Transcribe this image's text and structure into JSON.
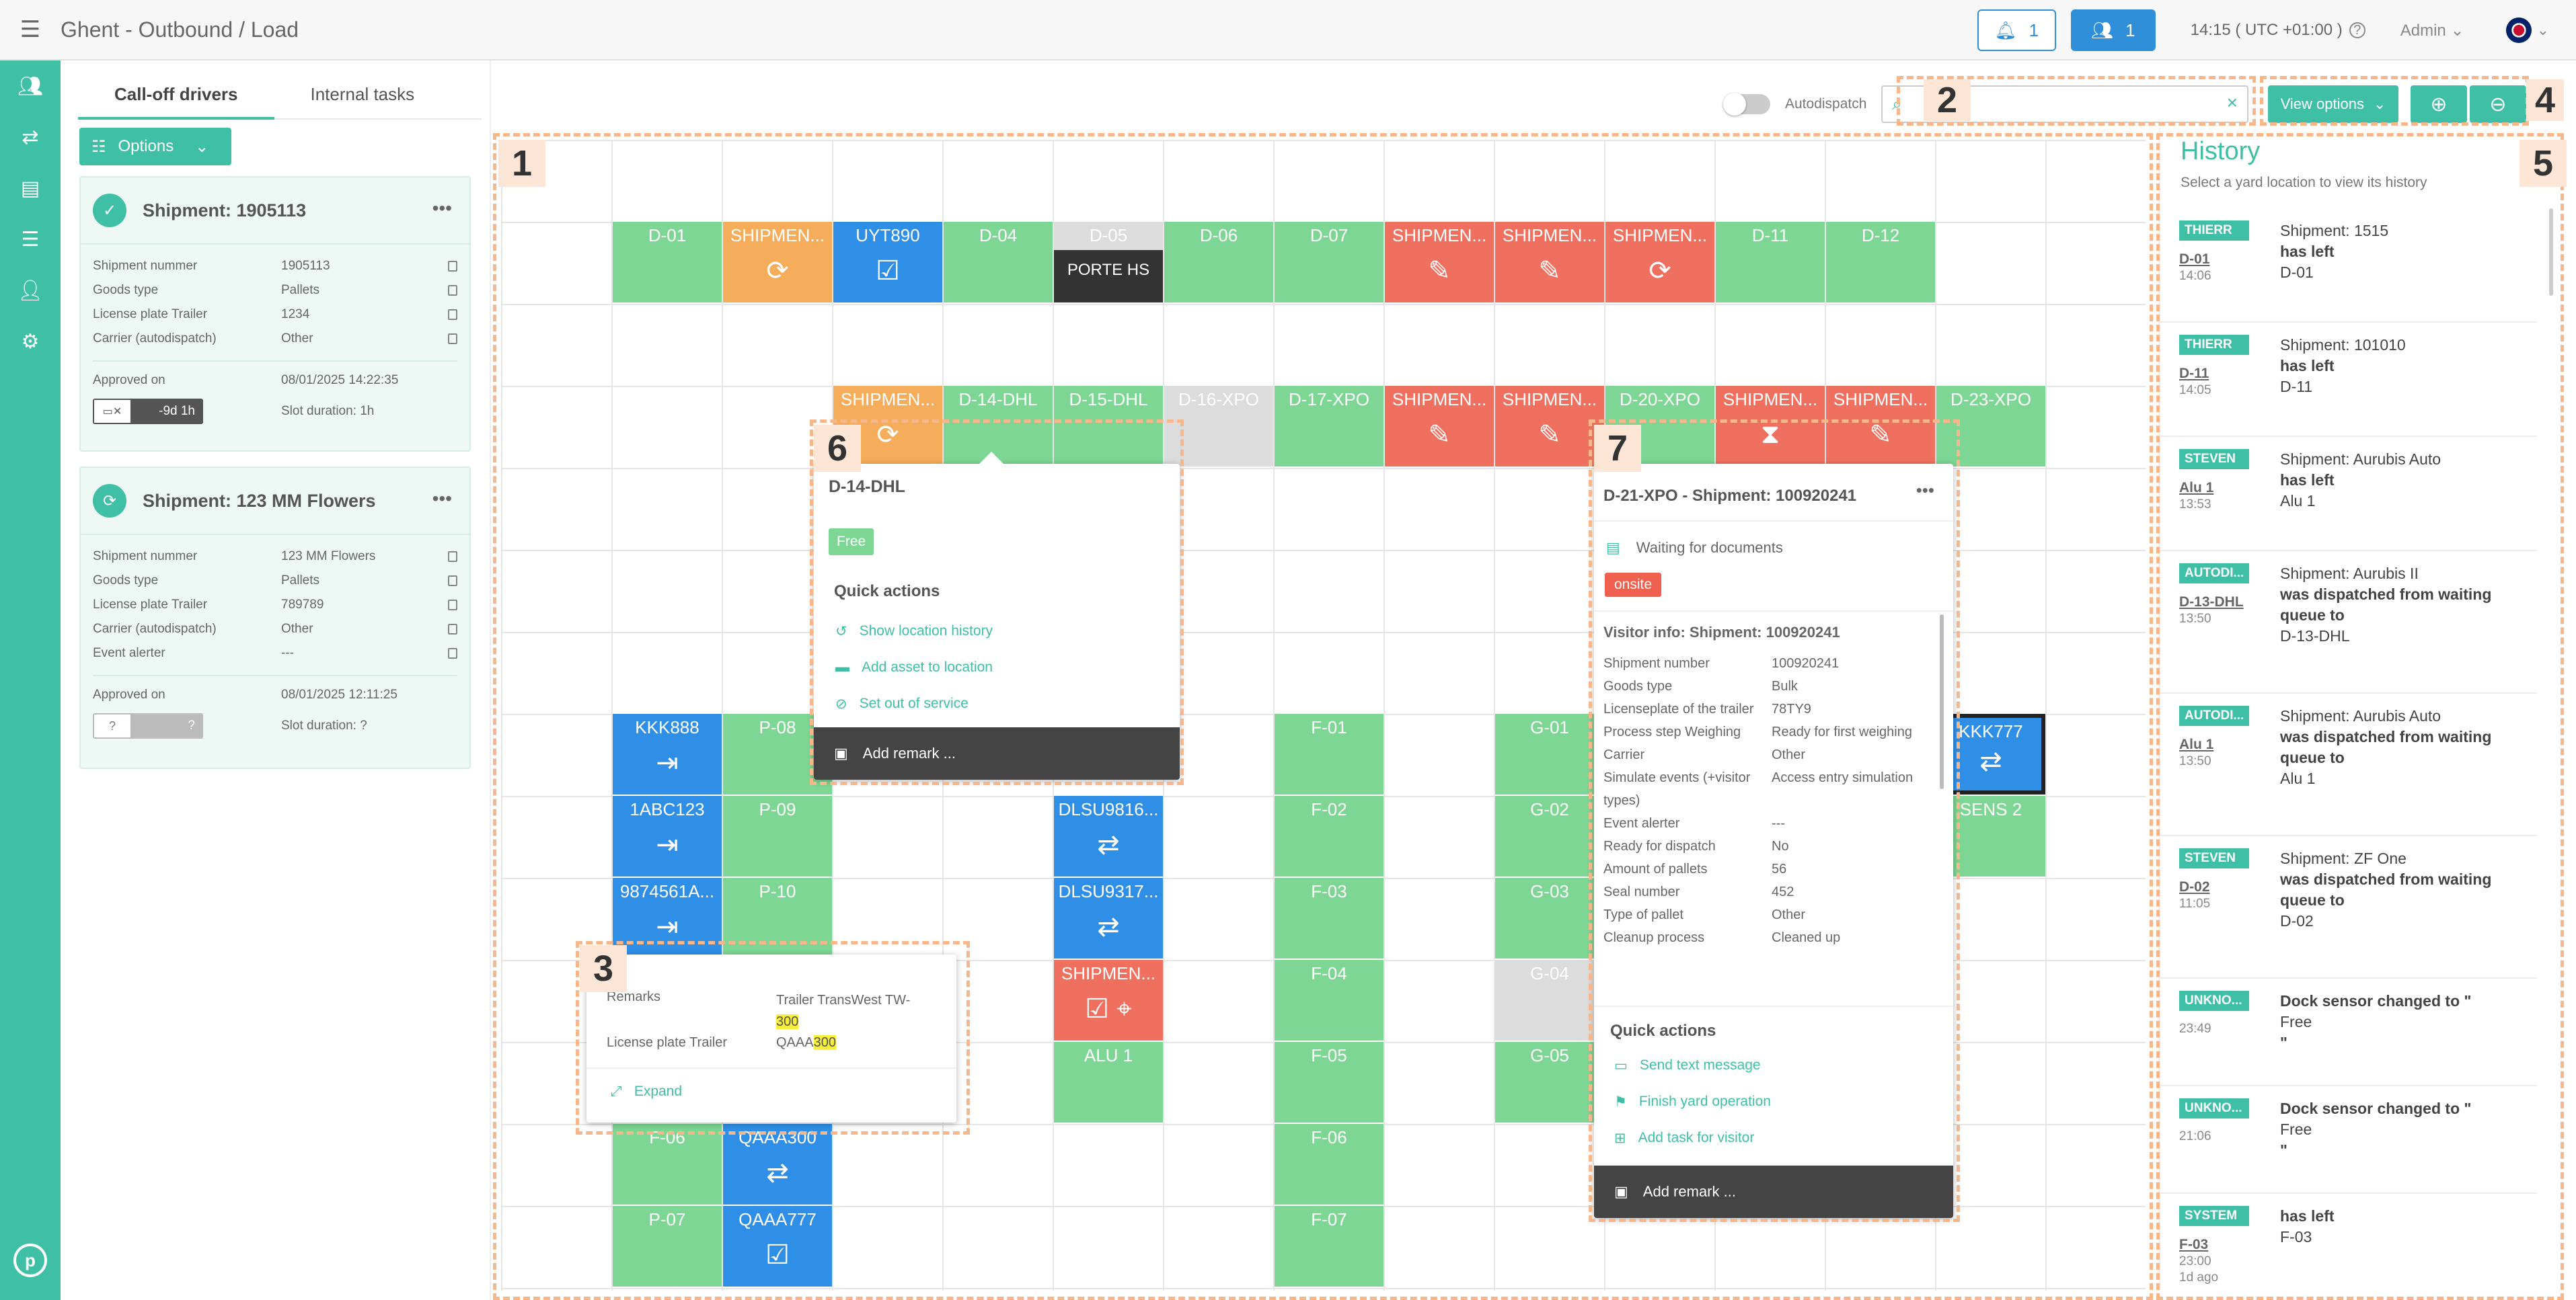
{
  "header": {
    "title": "Ghent - Outbound / Load",
    "notifications": "1",
    "users": "1",
    "clock": "14:15 ( UTC +01:00 )",
    "user": "Admin"
  },
  "left": {
    "tabs": [
      "Call-off drivers",
      "Internal tasks"
    ],
    "options_label": "Options",
    "cards": [
      {
        "title": "Shipment: 1905113",
        "rows": [
          [
            "Shipment nummer",
            "1905113"
          ],
          [
            "Goods type",
            "Pallets"
          ],
          [
            "License plate Trailer",
            "1234"
          ],
          [
            "Carrier (autodispatch)",
            "Other"
          ]
        ],
        "approved_label": "Approved on",
        "approved_value": "08/01/2025 14:22:35",
        "badge": "-9d 1h",
        "slot": "Slot duration: 1h"
      },
      {
        "title": "Shipment: 123 MM Flowers",
        "rows": [
          [
            "Shipment nummer",
            "123 MM Flowers"
          ],
          [
            "Goods type",
            "Pallets"
          ],
          [
            "License plate Trailer",
            "789789"
          ],
          [
            "Carrier (autodispatch)",
            "Other"
          ],
          [
            "Event alerter",
            "---"
          ]
        ],
        "approved_label": "Approved on",
        "approved_value": "08/01/2025 12:11:25",
        "badge": "?",
        "badge_icon": "?",
        "slot": "Slot duration: ?"
      }
    ]
  },
  "toolbar": {
    "autodispatch": "Autodispatch",
    "view_options": "View options"
  },
  "grid": {
    "row1": [
      {
        "c": "green",
        "l": "D-01"
      },
      {
        "c": "orange",
        "l": "SHIPMEN...",
        "i": "⟳"
      },
      {
        "c": "blue",
        "l": "UYT890",
        "i": "☑"
      },
      {
        "c": "green",
        "l": "D-04"
      },
      {
        "c": "grey",
        "l": "D-05",
        "porte": "PORTE HS"
      },
      {
        "c": "green",
        "l": "D-06"
      },
      {
        "c": "green",
        "l": "D-07"
      },
      {
        "c": "red",
        "l": "SHIPMEN...",
        "i": "✎"
      },
      {
        "c": "red",
        "l": "SHIPMEN...",
        "i": "✎"
      },
      {
        "c": "red",
        "l": "SHIPMEN...",
        "i": "⟳"
      },
      {
        "c": "green",
        "l": "D-11"
      },
      {
        "c": "green",
        "l": "D-12"
      }
    ],
    "row2": [
      {
        "c": "orange",
        "l": "SHIPMEN...",
        "i": "⟳"
      },
      {
        "c": "green",
        "l": "D-14-DHL"
      },
      {
        "c": "green",
        "l": "D-15-DHL"
      },
      {
        "c": "grey",
        "l": "D-16-XPO"
      },
      {
        "c": "green",
        "l": "D-17-XPO"
      },
      {
        "c": "red",
        "l": "SHIPMEN...",
        "i": "✎"
      },
      {
        "c": "red",
        "l": "SHIPMEN...",
        "i": "✎"
      },
      {
        "c": "green",
        "l": "D-20-XPO"
      },
      {
        "c": "red",
        "l": "SHIPMEN...",
        "i": "⧗"
      },
      {
        "c": "red",
        "l": "SHIPMEN...",
        "i": "✎"
      },
      {
        "c": "green",
        "l": "D-23-XPO"
      }
    ],
    "misc": {
      "kkk888": "KKK888",
      "p08": "P-08",
      "abc123": "1ABC123",
      "p09": "P-09",
      "n9874": "9874561A...",
      "p10": "P-10",
      "f06": "F-06",
      "qaaa300": "QAAA300",
      "p07": "P-07",
      "qaaa777": "QAAA777",
      "dlsu1": "DLSU9816...",
      "dlsu2": "DLSU9317...",
      "shipred": "SHIPMEN...",
      "alu1": "ALU 1",
      "f01": "F-01",
      "f02": "F-02",
      "f03": "F-03",
      "f04": "F-04",
      "f05": "F-05",
      "f06b": "F-06",
      "f07": "F-07",
      "g01": "G-01",
      "g02": "G-02",
      "g03": "G-03",
      "g04": "G-04",
      "g05": "G-05",
      "kkk777": "KKK777",
      "sens2": "SENS 2"
    }
  },
  "popup6": {
    "title": "D-14-DHL",
    "status": "Free",
    "qa_title": "Quick actions",
    "actions": [
      "Show location history",
      "Add asset to location",
      "Set out of service"
    ],
    "remark": "Add remark ..."
  },
  "popup3": {
    "remarks_label": "Remarks",
    "remarks_value_a": "Trailer TransWest TW-",
    "remarks_value_hl": "300",
    "lp_label": "License plate Trailer",
    "lp_value_a": "QAAA",
    "lp_value_hl": "300",
    "expand": "Expand"
  },
  "popup7": {
    "title": "D-21-XPO - Shipment: 100920241",
    "waiting": "Waiting for documents",
    "status": "onsite",
    "visitor_title": "Visitor info: Shipment: 100920241",
    "rows": [
      [
        "Shipment number",
        "100920241"
      ],
      [
        "Goods type",
        "Bulk"
      ],
      [
        "Licenseplate of the trailer",
        "78TY9"
      ],
      [
        "Process step Weighing",
        "Ready for first weighing"
      ],
      [
        "Carrier",
        "Other"
      ],
      [
        "Simulate events (+visitor types)",
        "Access entry simulation"
      ],
      [
        "Event alerter",
        "---"
      ],
      [
        "Ready for dispatch",
        "No"
      ],
      [
        "Amount of pallets",
        "56"
      ],
      [
        "Seal number",
        "452"
      ],
      [
        "Type of pallet",
        "Other"
      ],
      [
        "Cleanup process",
        "Cleaned up"
      ]
    ],
    "qa_title": "Quick actions",
    "actions": [
      "Send text message",
      "Finish yard operation",
      "Add task for visitor"
    ],
    "remark": "Add remark ..."
  },
  "history": {
    "title": "History",
    "subtitle": "Select a yard location to view its history",
    "items": [
      {
        "tag": "THIERR",
        "loc": "D-01",
        "time": "14:06",
        "l1": "Shipment: 1515",
        "l2": "has left",
        "l3": "D-01"
      },
      {
        "tag": "THIERR",
        "loc": "D-11",
        "time": "14:05",
        "l1": "Shipment: 101010",
        "l2": "has left",
        "l3": "D-11"
      },
      {
        "tag": "STEVEN",
        "loc": "Alu 1",
        "time": "13:53",
        "l1": "Shipment: Aurubis Auto",
        "l2": "has left",
        "l3": "Alu 1"
      },
      {
        "tag": "AUTODI...",
        "loc": "D-13-DHL",
        "time": "13:50",
        "l1": "Shipment: Aurubis II",
        "l2": "was dispatched from waiting queue to",
        "l3": "D-13-DHL"
      },
      {
        "tag": "AUTODI...",
        "loc": "Alu 1",
        "time": "13:50",
        "l1": "Shipment: Aurubis Auto",
        "l2": "was dispatched from waiting queue to",
        "l3": "Alu 1"
      },
      {
        "tag": "STEVEN",
        "loc": "D-02",
        "time": "11:05",
        "l1": "Shipment: ZF One",
        "l2": "was dispatched from waiting queue to",
        "l3": "D-02"
      },
      {
        "tag": "UNKNO...",
        "loc": "",
        "time": "23:49",
        "l1": "",
        "l2": "Dock sensor changed to \"",
        "l3": "Free",
        "l4": "\""
      },
      {
        "tag": "UNKNO...",
        "loc": "",
        "time": "21:06",
        "l1": "",
        "l2": "Dock sensor changed to \"",
        "l3": "Free",
        "l4": "\""
      },
      {
        "tag": "SYSTEM",
        "loc": "F-03",
        "time": "23:00",
        "time2": "1d ago",
        "l1": "",
        "l2": "has left",
        "l3": "F-03"
      }
    ]
  },
  "annotations": [
    "1",
    "2",
    "3",
    "4",
    "5",
    "6",
    "7"
  ]
}
